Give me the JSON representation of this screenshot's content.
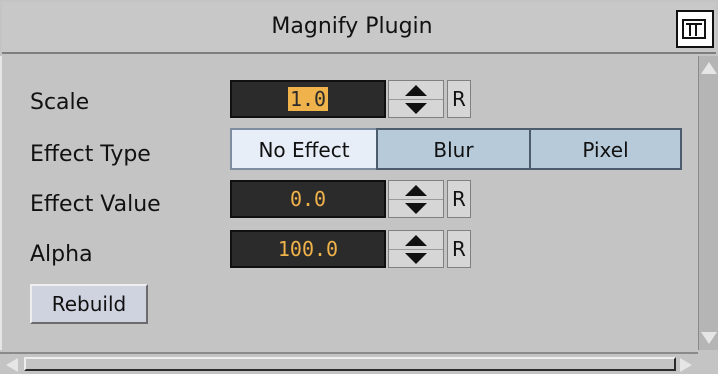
{
  "window": {
    "title": "Magnify Plugin",
    "icon": "window-menu-icon"
  },
  "fields": {
    "scale": {
      "label": "Scale",
      "value": "1.0",
      "reset_label": "R"
    },
    "effect_type": {
      "label": "Effect Type",
      "options": [
        "No Effect",
        "Blur",
        "Pixel"
      ],
      "selected": "No Effect"
    },
    "effect_value": {
      "label": "Effect Value",
      "value": "0.0",
      "reset_label": "R"
    },
    "alpha": {
      "label": "Alpha",
      "value": "100.0",
      "reset_label": "R"
    }
  },
  "buttons": {
    "rebuild_label": "Rebuild"
  },
  "colors": {
    "field_bg": "#2b2b2b",
    "field_text": "#f0b24a",
    "segment_active": "#e7eef8",
    "segment_inactive": "#b6cada"
  }
}
